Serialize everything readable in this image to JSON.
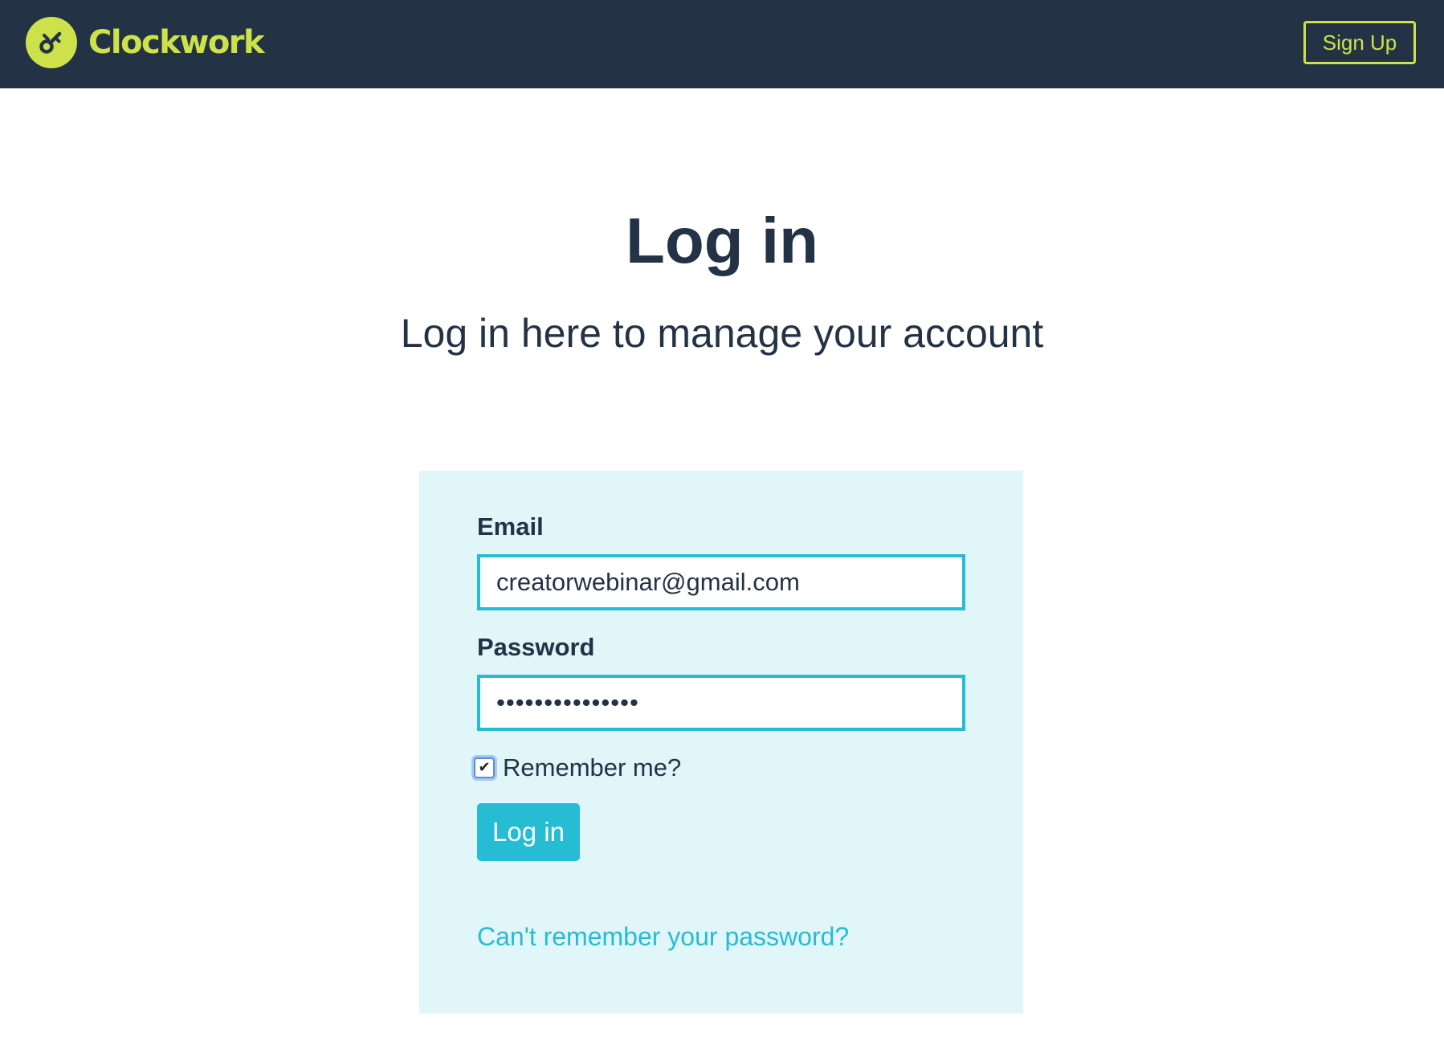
{
  "header": {
    "brand_name": "Clockwork",
    "brand_icon": "clockwork-key-icon",
    "signup_label": "Sign Up"
  },
  "main": {
    "title": "Log in",
    "subtitle": "Log in here to manage your account"
  },
  "form": {
    "email_label": "Email",
    "email_value": "creatorwebinar@gmail.com",
    "password_label": "Password",
    "password_value": "•••••••••••••••",
    "remember_label": "Remember me?",
    "remember_checked": true,
    "submit_label": "Log in",
    "forgot_label": "Can't remember your password?"
  },
  "colors": {
    "header_bg": "#233245",
    "brand_accent": "#cde24a",
    "primary": "#26bcd3",
    "card_bg": "#e0f6f9",
    "text": "#233245"
  }
}
